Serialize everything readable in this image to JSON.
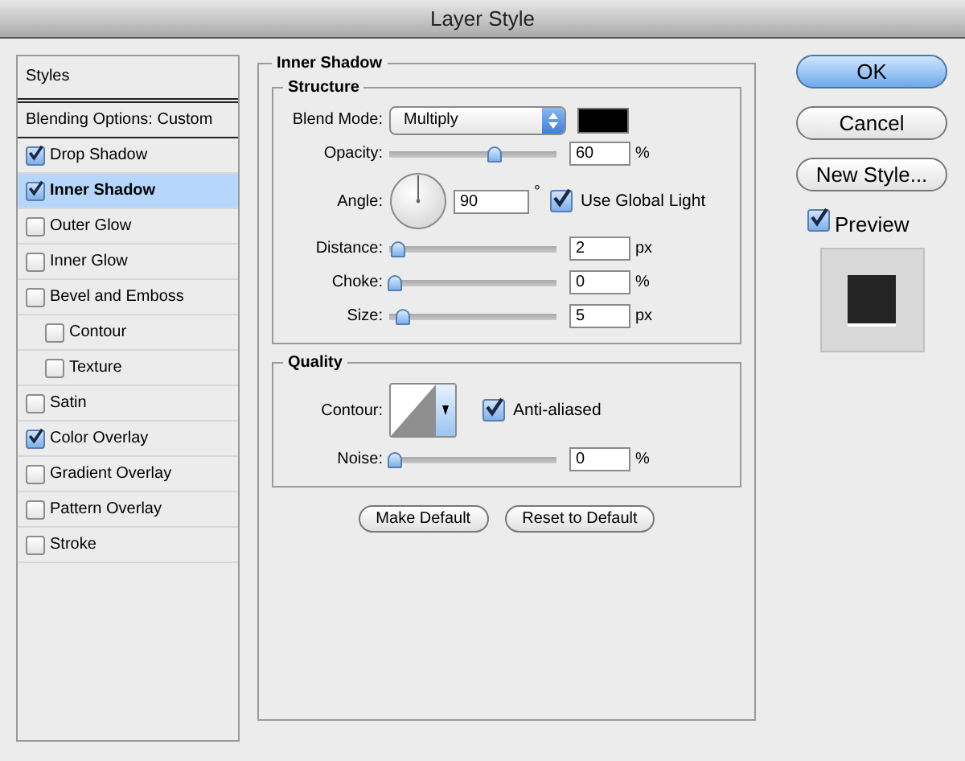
{
  "window": {
    "title": "Layer Style"
  },
  "styles_panel": {
    "header": "Styles",
    "blending_options": "Blending Options: Custom",
    "items": [
      {
        "label": "Drop Shadow",
        "checked": true,
        "selected": false
      },
      {
        "label": "Inner Shadow",
        "checked": true,
        "selected": true
      },
      {
        "label": "Outer Glow",
        "checked": false,
        "selected": false
      },
      {
        "label": "Inner Glow",
        "checked": false,
        "selected": false
      },
      {
        "label": "Bevel and Emboss",
        "checked": false,
        "selected": false,
        "children": [
          {
            "label": "Contour",
            "checked": false,
            "selected": false
          },
          {
            "label": "Texture",
            "checked": false,
            "selected": false
          }
        ]
      },
      {
        "label": "Satin",
        "checked": false,
        "selected": false
      },
      {
        "label": "Color Overlay",
        "checked": true,
        "selected": false
      },
      {
        "label": "Gradient Overlay",
        "checked": false,
        "selected": false
      },
      {
        "label": "Pattern Overlay",
        "checked": false,
        "selected": false
      },
      {
        "label": "Stroke",
        "checked": false,
        "selected": false
      }
    ]
  },
  "settings": {
    "title": "Inner Shadow",
    "groups": [
      {
        "title": "Structure",
        "rows": [
          {
            "kind": "select",
            "label": "Blend Mode:",
            "value": "Multiply"
          },
          {
            "kind": "slider",
            "label": "Opacity:",
            "level": 0.6,
            "value": "60",
            "unit": "%"
          },
          {
            "kind": "angle",
            "label": "Angle:",
            "value": "90",
            "unit": "°",
            "option": {
              "label": "Use Global Light",
              "checked": true
            }
          },
          {
            "kind": "slider",
            "label": "Distance:",
            "level": 0.02,
            "value": "2",
            "unit": "px"
          },
          {
            "kind": "slider",
            "label": "Choke:",
            "level": 0,
            "value": "0",
            "unit": "%"
          },
          {
            "kind": "slider",
            "label": "Size:",
            "level": 0.05,
            "value": "5",
            "unit": "px"
          }
        ]
      },
      {
        "title": "Quality",
        "rows": [
          {
            "kind": "contour",
            "label": "Contour:",
            "option": {
              "label": "Anti-aliased",
              "checked": true
            }
          },
          {
            "kind": "slider",
            "label": "Noise:",
            "level": 0,
            "value": "0",
            "unit": "%"
          }
        ]
      }
    ],
    "buttons": [
      "Make Default",
      "Reset to Default"
    ]
  },
  "actions": [
    {
      "label": "OK",
      "default": true
    },
    {
      "label": "Cancel",
      "default": false
    },
    {
      "label": "New Style...",
      "default": false
    }
  ],
  "preview": {
    "label": "Preview",
    "checked": true
  }
}
